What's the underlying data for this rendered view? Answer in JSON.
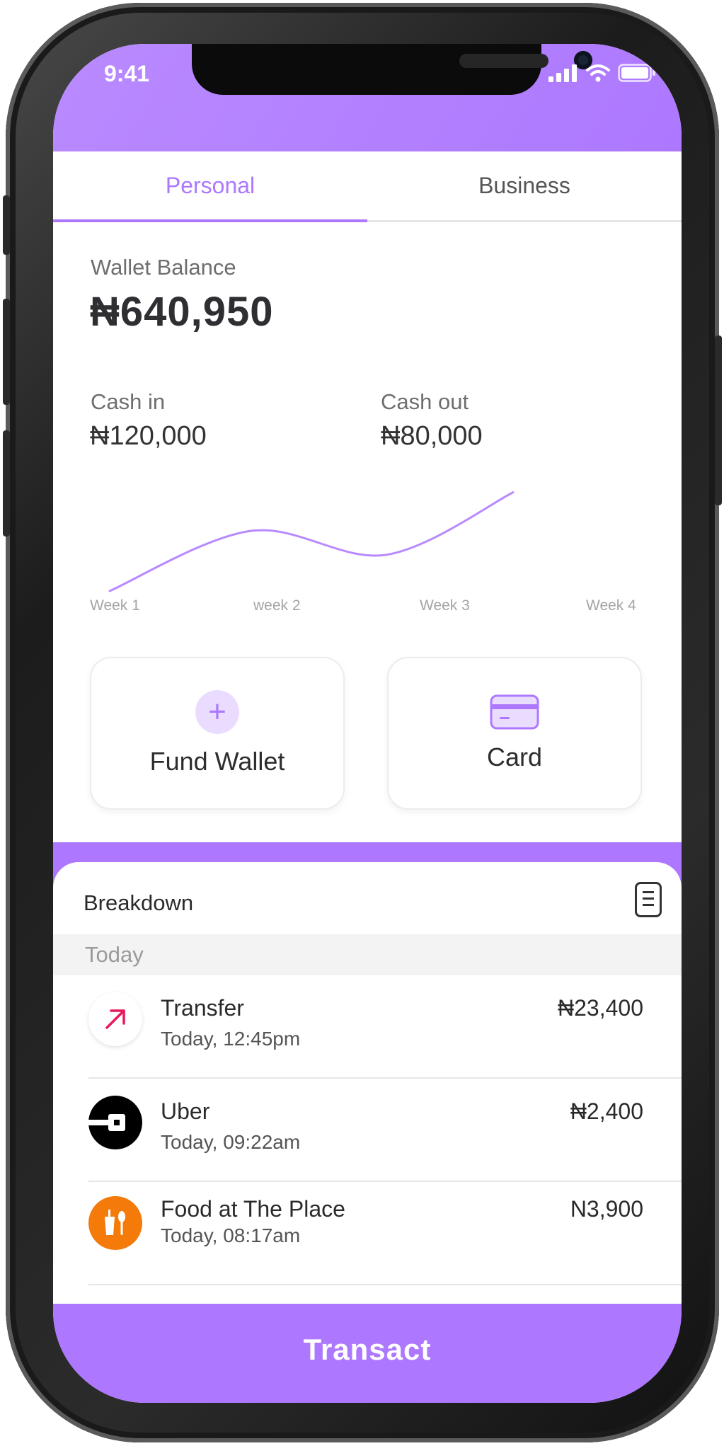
{
  "status_bar": {
    "time": "9:41"
  },
  "tabs": [
    {
      "label": "Personal",
      "active": true
    },
    {
      "label": "Business",
      "active": false
    }
  ],
  "wallet": {
    "label": "Wallet Balance",
    "value": "₦640,950"
  },
  "cash_in": {
    "label": "Cash in",
    "value": "₦120,000"
  },
  "cash_out": {
    "label": "Cash out",
    "value": "₦80,000"
  },
  "chart_data": {
    "type": "line",
    "categories": [
      "Week 1",
      "week 2",
      "Week 3",
      "Week 4"
    ],
    "series": [
      {
        "values": [
          10,
          60,
          40,
          92
        ]
      }
    ],
    "ylim": [
      0,
      100
    ],
    "grid": false,
    "color": "#b98aff"
  },
  "actions": {
    "fund_wallet": {
      "label": "Fund Wallet",
      "icon": "plus-icon"
    },
    "card": {
      "label": "Card",
      "icon": "card-icon"
    }
  },
  "breakdown": {
    "title": "Breakdown",
    "section": "Today",
    "transactions": [
      {
        "name": "Transfer",
        "time": "Today, 12:45pm",
        "amount": "₦23,400",
        "icon": "arrow-up-right-icon"
      },
      {
        "name": "Uber",
        "time": "Today, 09:22am",
        "amount": "₦2,400",
        "icon": "uber-icon"
      },
      {
        "name": "Food at The Place",
        "time": "Today, 08:17am",
        "amount": "N3,900",
        "icon": "food-icon"
      }
    ]
  },
  "footer": {
    "transact_label": "Transact"
  },
  "colors": {
    "accent": "#ad78ff",
    "accent_light": "#eadcff",
    "transfer": "#e8185a",
    "food": "#f47b0a"
  }
}
